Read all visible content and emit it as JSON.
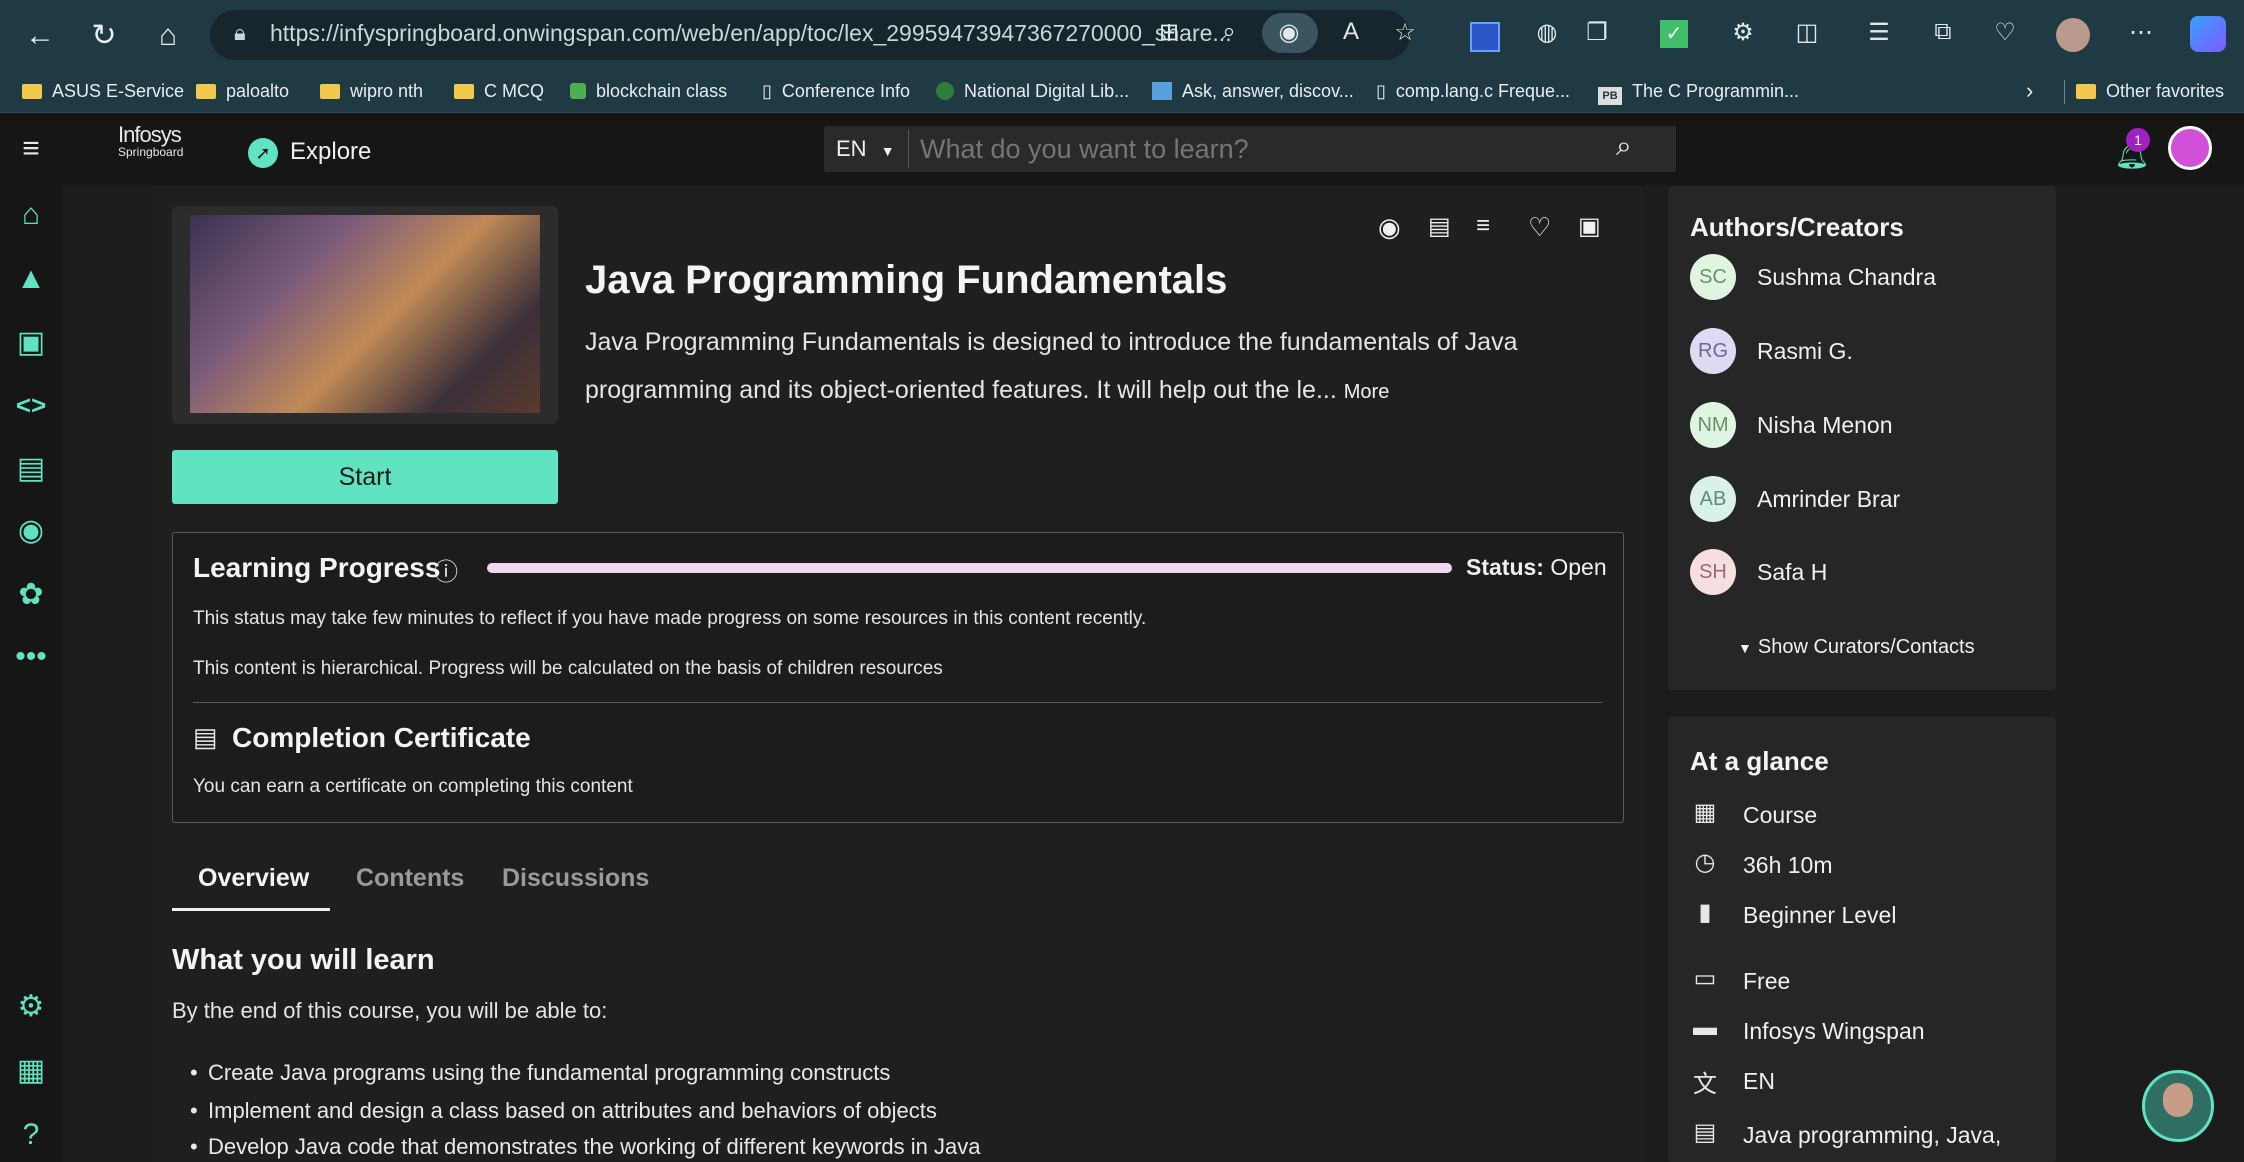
{
  "browser": {
    "url": "https://infyspringboard.onwingspan.com/web/en/app/toc/lex_29959473947367270000_share...",
    "bookmarks": [
      "ASUS E-Service",
      "paloalto",
      "wipro nth",
      "C MCQ",
      "blockchain class",
      "Conference Info",
      "National Digital Lib...",
      "Ask, answer, discov...",
      "comp.lang.c Freque...",
      "The C Programmin..."
    ],
    "other_favorites": "Other favorites"
  },
  "header": {
    "logo_line1": "Infosys",
    "logo_line2": "Springboard",
    "explore": "Explore",
    "lang": "EN",
    "search_placeholder": "What do you want to learn?",
    "notifications_count": "1"
  },
  "course": {
    "title": "Java Programming Fundamentals",
    "description_line1": "Java Programming Fundamentals is designed to introduce the fundamentals of Java",
    "description_line2": "programming and its object-oriented features. It will help out the le...",
    "more": "More",
    "start_label": "Start"
  },
  "progress": {
    "heading": "Learning Progress",
    "status_label": "Status:",
    "status_value": "Open",
    "percent": 100,
    "note1": "This status may take few minutes to reflect if you have made progress on some resources in this content recently.",
    "note2": "This content is hierarchical. Progress will be calculated on the basis of children resources",
    "cert_heading": "Completion Certificate",
    "cert_text": "You can earn a certificate on completing this content"
  },
  "tabs": [
    "Overview",
    "Contents",
    "Discussions"
  ],
  "overview": {
    "heading": "What you will learn",
    "intro": "By the end of this course, you will be able to:",
    "items": [
      "Create Java programs using the fundamental programming constructs",
      "Implement and design a class based on attributes and behaviors of objects",
      "Develop Java code that demonstrates the working of different keywords in Java"
    ]
  },
  "authors": {
    "heading": "Authors/Creators",
    "list": [
      {
        "initials": "SC",
        "name": "Sushma Chandra",
        "bg": "#dff5e1",
        "fg": "#6a8f6e"
      },
      {
        "initials": "RG",
        "name": "Rasmi G.",
        "bg": "#dedaf3",
        "fg": "#6f6a92"
      },
      {
        "initials": "NM",
        "name": "Nisha Menon",
        "bg": "#dff5e1",
        "fg": "#6a8f6e"
      },
      {
        "initials": "AB",
        "name": "Amrinder Brar",
        "bg": "#d9f1ea",
        "fg": "#5e8a7e"
      },
      {
        "initials": "SH",
        "name": "Safa H",
        "bg": "#f6dfe1",
        "fg": "#9a6a70"
      }
    ],
    "show_curators": "Show Curators/Contacts"
  },
  "glance": {
    "heading": "At a glance",
    "items": [
      {
        "icon": "widgets-icon",
        "glyph": "▦",
        "text": "Course"
      },
      {
        "icon": "clock-icon",
        "glyph": "◷",
        "text": "36h 10m"
      },
      {
        "icon": "level-bars-icon",
        "glyph": "▮",
        "text": "Beginner Level"
      },
      {
        "icon": "card-icon",
        "glyph": "▭",
        "text": "Free"
      },
      {
        "icon": "folder-icon",
        "glyph": "▬",
        "text": "Infosys Wingspan"
      },
      {
        "icon": "translate-icon",
        "glyph": "文",
        "text": "EN"
      },
      {
        "icon": "tags-icon",
        "glyph": "▤",
        "text": "Java programming, Java,"
      }
    ]
  },
  "colors": {
    "accent": "#5fe3c0",
    "progress_fill": "#f0d7ee",
    "notify_badge": "#a020c0"
  }
}
